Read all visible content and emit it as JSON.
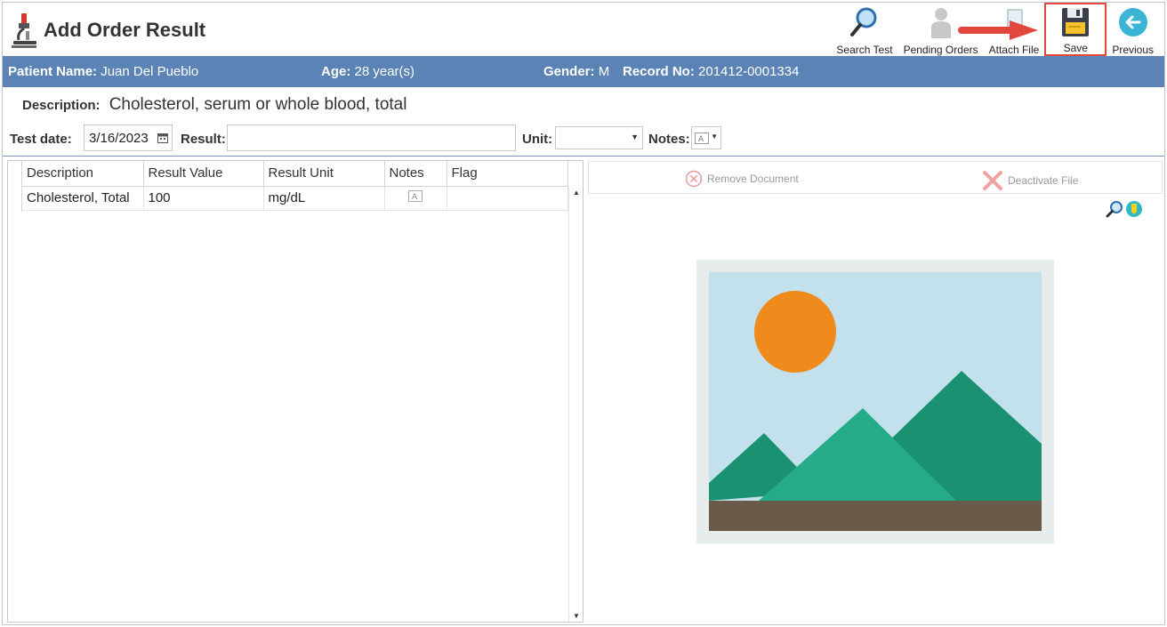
{
  "header": {
    "title": "Add Order Result",
    "toolbar": [
      {
        "label": "Search Test",
        "icon": "magnifier-icon"
      },
      {
        "label": "Pending Orders",
        "icon": "person-icon"
      },
      {
        "label": "Attach File",
        "icon": "attach-file-icon"
      },
      {
        "label": "Save",
        "icon": "floppy-disk-icon"
      },
      {
        "label": "Previous",
        "icon": "back-arrow-icon"
      }
    ]
  },
  "patient": {
    "name_label": "Patient Name:",
    "name": "Juan Del Pueblo",
    "age_label": "Age:",
    "age": "28 year(s)",
    "gender_label": "Gender:",
    "gender": "M",
    "record_label": "Record No:",
    "record": "201412-0001334"
  },
  "description": {
    "label": "Description:",
    "value": "Cholesterol, serum or whole blood, total"
  },
  "form": {
    "test_date_label": "Test date:",
    "test_date": "3/16/2023",
    "result_label": "Result:",
    "result": "",
    "unit_label": "Unit:",
    "unit": "",
    "notes_label": "Notes:"
  },
  "grid": {
    "columns": [
      "Description",
      "Result Value",
      "Result Unit",
      "Notes",
      "Flag"
    ],
    "rows": [
      {
        "description": "Cholesterol, Total",
        "value": "100",
        "unit": "mg/dL",
        "notes": "",
        "flag": ""
      }
    ]
  },
  "document_panel": {
    "remove_label": "Remove Document",
    "deactivate_label": "Deactivate File"
  },
  "colors": {
    "patient_bar": "#5b83b5",
    "highlight": "#e2463c",
    "sky": "#c3e1ec",
    "sun": "#ef8a1c",
    "mountain_dark": "#1a9171",
    "mountain_light": "#25ab88",
    "ground": "#6a5a4a"
  }
}
